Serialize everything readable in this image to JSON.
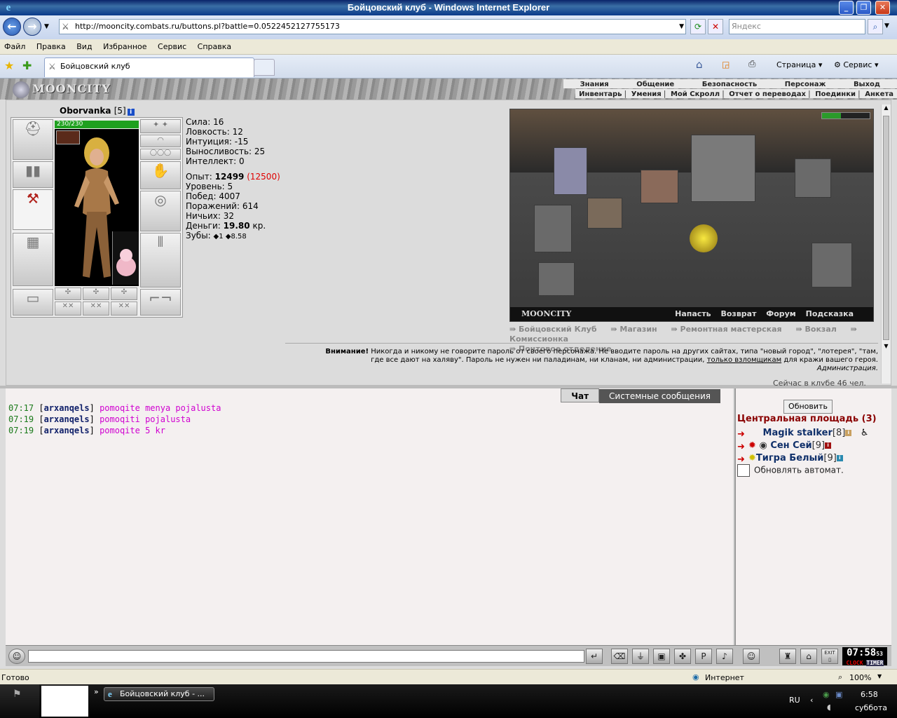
{
  "window": {
    "title": "Бойцовский клуб - Windows Internet Explorer"
  },
  "addressbar": {
    "url": "http://mooncity.combats.ru/buttons.pl?battle=0.0522452127755173",
    "search_placeholder": "Яндекс"
  },
  "menubar": [
    "Файл",
    "Правка",
    "Вид",
    "Избранное",
    "Сервис",
    "Справка"
  ],
  "tabs": {
    "active": "Бойцовский клуб",
    "page_label": "Страница",
    "service_label": "Сервис"
  },
  "game_menu": {
    "top": [
      "Знания",
      "Общение",
      "Безопасность",
      "Персонаж",
      "Выход"
    ],
    "sub": [
      "Инвентарь",
      "Умения",
      "Мой Скролл",
      "Отчет о переводах",
      "Поединки",
      "Анкета"
    ]
  },
  "logo": "MOONCITY",
  "character": {
    "name": "Oborvanka",
    "level": "[5]",
    "hp": "230/230",
    "stats": [
      {
        "label": "Сила:",
        "value": "16"
      },
      {
        "label": "Ловкость:",
        "value": "12"
      },
      {
        "label": "Интуиция:",
        "value": "-15"
      },
      {
        "label": "Выносливость:",
        "value": "25"
      },
      {
        "label": "Интеллект:",
        "value": "0"
      }
    ],
    "exp_label": "Опыт:",
    "exp": "12499",
    "exp_next": "(12500)",
    "level_label": "Уровень:",
    "level_value": "5",
    "wins_label": "Побед:",
    "wins": "4007",
    "losses_label": "Поражений:",
    "losses": "614",
    "draws_label": "Ничьих:",
    "draws": "32",
    "money_label": "Деньги:",
    "money": "19.80",
    "money_unit": "кр.",
    "teeth_label": "Зубы:",
    "teeth_a": "1",
    "teeth_b": "8.58"
  },
  "scene": {
    "caption": "MOONCITY",
    "links": [
      "Напасть",
      "Возврат",
      "Форум",
      "Подсказка"
    ]
  },
  "shortcuts": [
    "Бойцовский Клуб",
    "Магазин",
    "Ремонтная мастерская",
    "Вокзал",
    "Комиссионка",
    "Почтовое отделение"
  ],
  "warning": {
    "bold": "Внимание!",
    "text1": "Никогда и никому не говорите пароль от своего персонажа. Не вводите пароль на других сайтах, типа \"новый город\", \"лотерея\", \"там,",
    "text2a": "где все дают на халяву\". Пароль не нужен ни паладинам, ни кланам, ни администрации,",
    "text2u": "только взломщикам",
    "text2b": "для кражи вашего героя.",
    "signature": "Администрация.",
    "online": "Сейчас в клубе 46 чел."
  },
  "chat": {
    "tabs": [
      "Чат",
      "Системные сообщения"
    ],
    "lines": [
      {
        "time": "07:17",
        "user": "arxanqels",
        "msg": "pomoqite menya pojalusta"
      },
      {
        "time": "07:19",
        "user": "arxanqels",
        "msg": "pomoqiti pojalusta"
      },
      {
        "time": "07:19",
        "user": "arxanqels",
        "msg": "pomoqite 5 kr"
      }
    ]
  },
  "room": {
    "refresh": "Обновить",
    "title": "Центральная площадь (3)",
    "users": [
      {
        "name": "Magik stalker",
        "level": "[8]"
      },
      {
        "name": "Сен Сей",
        "level": "[9]"
      },
      {
        "name": "Тигра Белый",
        "level": "[9]"
      }
    ],
    "auto_label": "Обновлять автомат."
  },
  "clock": {
    "time": "07:58",
    "seconds": "53",
    "clock_label": "CLOCK",
    "timer_label": "TIMER",
    "exit": "EXIT"
  },
  "statusbar": {
    "left": "Готово",
    "zone": "Интернет",
    "zoom": "100%"
  },
  "taskbar": {
    "task": "Бойцовский клуб - ...",
    "lang": "RU",
    "time": "6:58",
    "day": "суббота"
  }
}
